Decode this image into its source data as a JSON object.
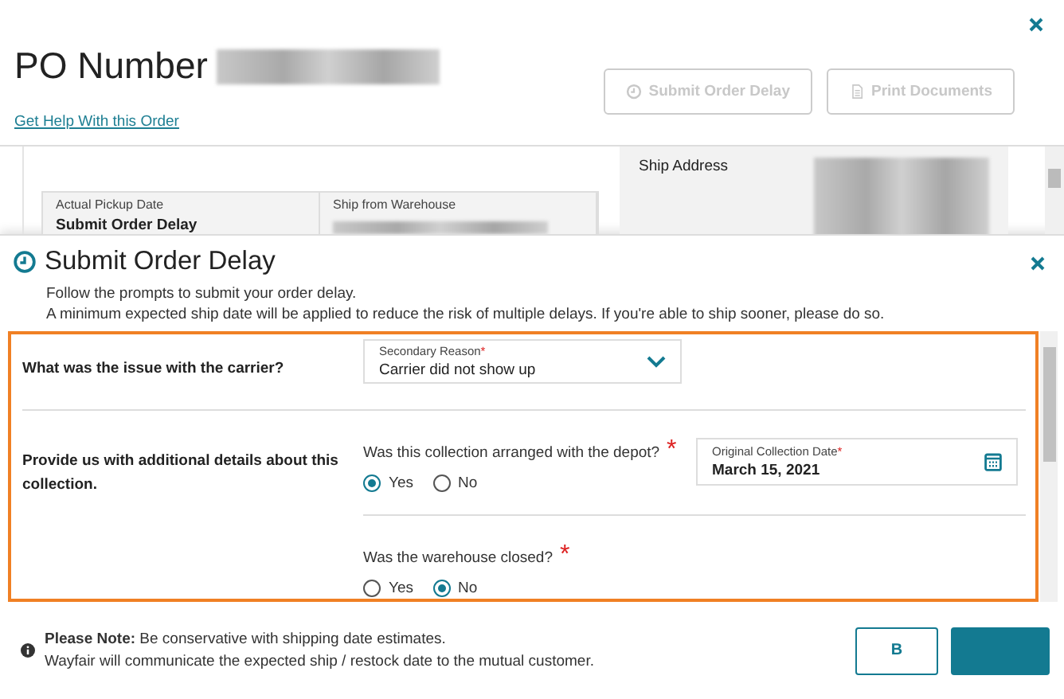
{
  "background_page": {
    "title": "PO Number",
    "help_link": "Get Help With this Order",
    "buttons": [
      {
        "label": "Submit Order Delay",
        "disabled": true
      },
      {
        "label": "Print Documents",
        "disabled": true
      }
    ],
    "details": [
      {
        "label": "Actual Pickup Date",
        "value": "Submit Order Delay"
      },
      {
        "label": "Ship from Warehouse"
      }
    ],
    "ship_address_label": "Ship Address"
  },
  "dialog": {
    "title": "Submit Order Delay",
    "description": [
      "Follow the prompts to submit your order delay.",
      "A minimum expected ship date will be applied to reduce the risk of multiple delays. If you're able to ship sooner, please do so."
    ],
    "sections": [
      {
        "label": "What was the issue with the carrier?",
        "rows": [
          {
            "fields": [
              {
                "kind": "select",
                "label": "Secondary Reason",
                "required_mark": "*",
                "value": "Carrier did not show up"
              }
            ]
          }
        ]
      },
      {
        "label": "Provide us with additional details about this collection.",
        "rows": [
          {
            "fields": [
              {
                "kind": "radio",
                "question": "Was this collection arranged with the depot?",
                "required_mark": "*",
                "options": [
                  {
                    "label": "Yes",
                    "selected": true
                  },
                  {
                    "label": "No",
                    "selected": false
                  }
                ]
              },
              {
                "kind": "date",
                "label": "Original Collection Date",
                "required_mark": "*",
                "value": "March 15, 2021"
              }
            ]
          },
          {
            "fields": [
              {
                "kind": "radio",
                "question": "Was the warehouse closed?",
                "required_mark": "*",
                "options": [
                  {
                    "label": "Yes",
                    "selected": false
                  },
                  {
                    "label": "No",
                    "selected": true
                  }
                ]
              }
            ]
          }
        ]
      }
    ],
    "note": [
      "**Please Note:** Be conservative with shipping date estimates.",
      "Wayfair will communicate the expected ship / restock date to the mutual customer."
    ],
    "buttons": [
      {
        "kind": "secondary",
        "label": "B"
      },
      {
        "kind": "primary"
      }
    ]
  }
}
